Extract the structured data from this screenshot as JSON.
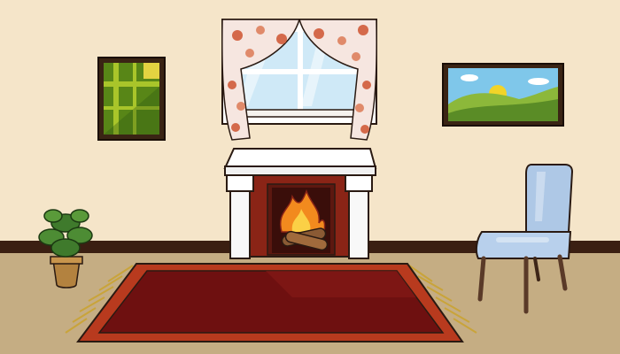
{
  "scene": {
    "type": "point-and-click room",
    "objects": [
      "left-painting",
      "window",
      "right-painting",
      "fireplace",
      "potted-plant",
      "rug",
      "chair"
    ]
  },
  "colors": {
    "wall": "#f5e5c9",
    "floor": "#c5ad83",
    "baseboard": "#3b1f12",
    "rug_outer": "#b83a1e",
    "rug_inner": "#6e1010",
    "rug_fringe": "#c9a43a",
    "fireplace_brick": "#8a2416",
    "mantel": "#f8f8f8",
    "chair_fabric": "#aec8e6",
    "chair_legs": "#5a3a28",
    "curtain": "#f6e6e0",
    "curtain_flower": "#d4694a",
    "sky": "#cfe9f7",
    "flame": "#f28a1e",
    "plant_leaf": "#3f7a2c",
    "pot": "#b3823f"
  }
}
